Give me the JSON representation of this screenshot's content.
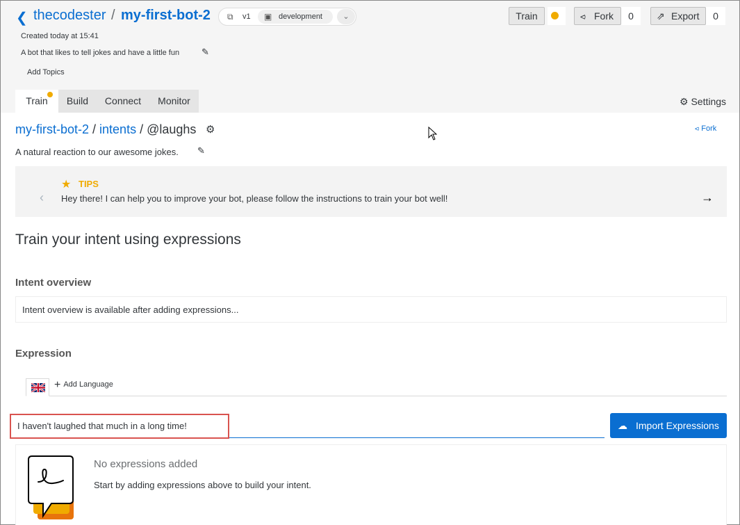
{
  "header": {
    "back_icon": "chevron-left-icon",
    "user": "thecodester",
    "separator": "/",
    "bot": "my-first-bot-2",
    "version_label": "v1",
    "environment": "development",
    "created": "Created today at 15:41",
    "description": "A bot that likes to tell jokes and have a little fun",
    "add_topics": "Add Topics",
    "train_label": "Train",
    "train_status_color": "#f0ab00",
    "fork_label": "Fork",
    "fork_count": "0",
    "export_label": "Export",
    "export_count": "0"
  },
  "tabs": [
    {
      "label": "Train",
      "active": true
    },
    {
      "label": "Build",
      "active": false
    },
    {
      "label": "Connect",
      "active": false
    },
    {
      "label": "Monitor",
      "active": false
    }
  ],
  "settings_label": "Settings",
  "intent": {
    "crumb_bot": "my-first-bot-2",
    "crumb_sep": " / ",
    "crumb_intents": "intents",
    "crumb_name": "@laughs",
    "fork_link": "Fork",
    "description": "A natural reaction to our awesome jokes."
  },
  "tips": {
    "title": "TIPS",
    "text": "Hey there! I can help you to improve your bot, please follow the instructions to train your bot well!"
  },
  "main": {
    "section_title": "Train your intent using expressions",
    "overview_label": "Intent overview",
    "overview_text": "Intent overview is available after adding expressions...",
    "expression_label": "Expression",
    "add_language": "Add Language",
    "expression_value": "I haven't laughed that much in a long time!",
    "import_label": "Import Expressions",
    "empty_title": "No expressions added",
    "empty_text": "Start by adding expressions above to build your intent."
  },
  "colors": {
    "accent": "#0a6ed1",
    "warning": "#f0ab00",
    "highlight": "#d9534f"
  }
}
